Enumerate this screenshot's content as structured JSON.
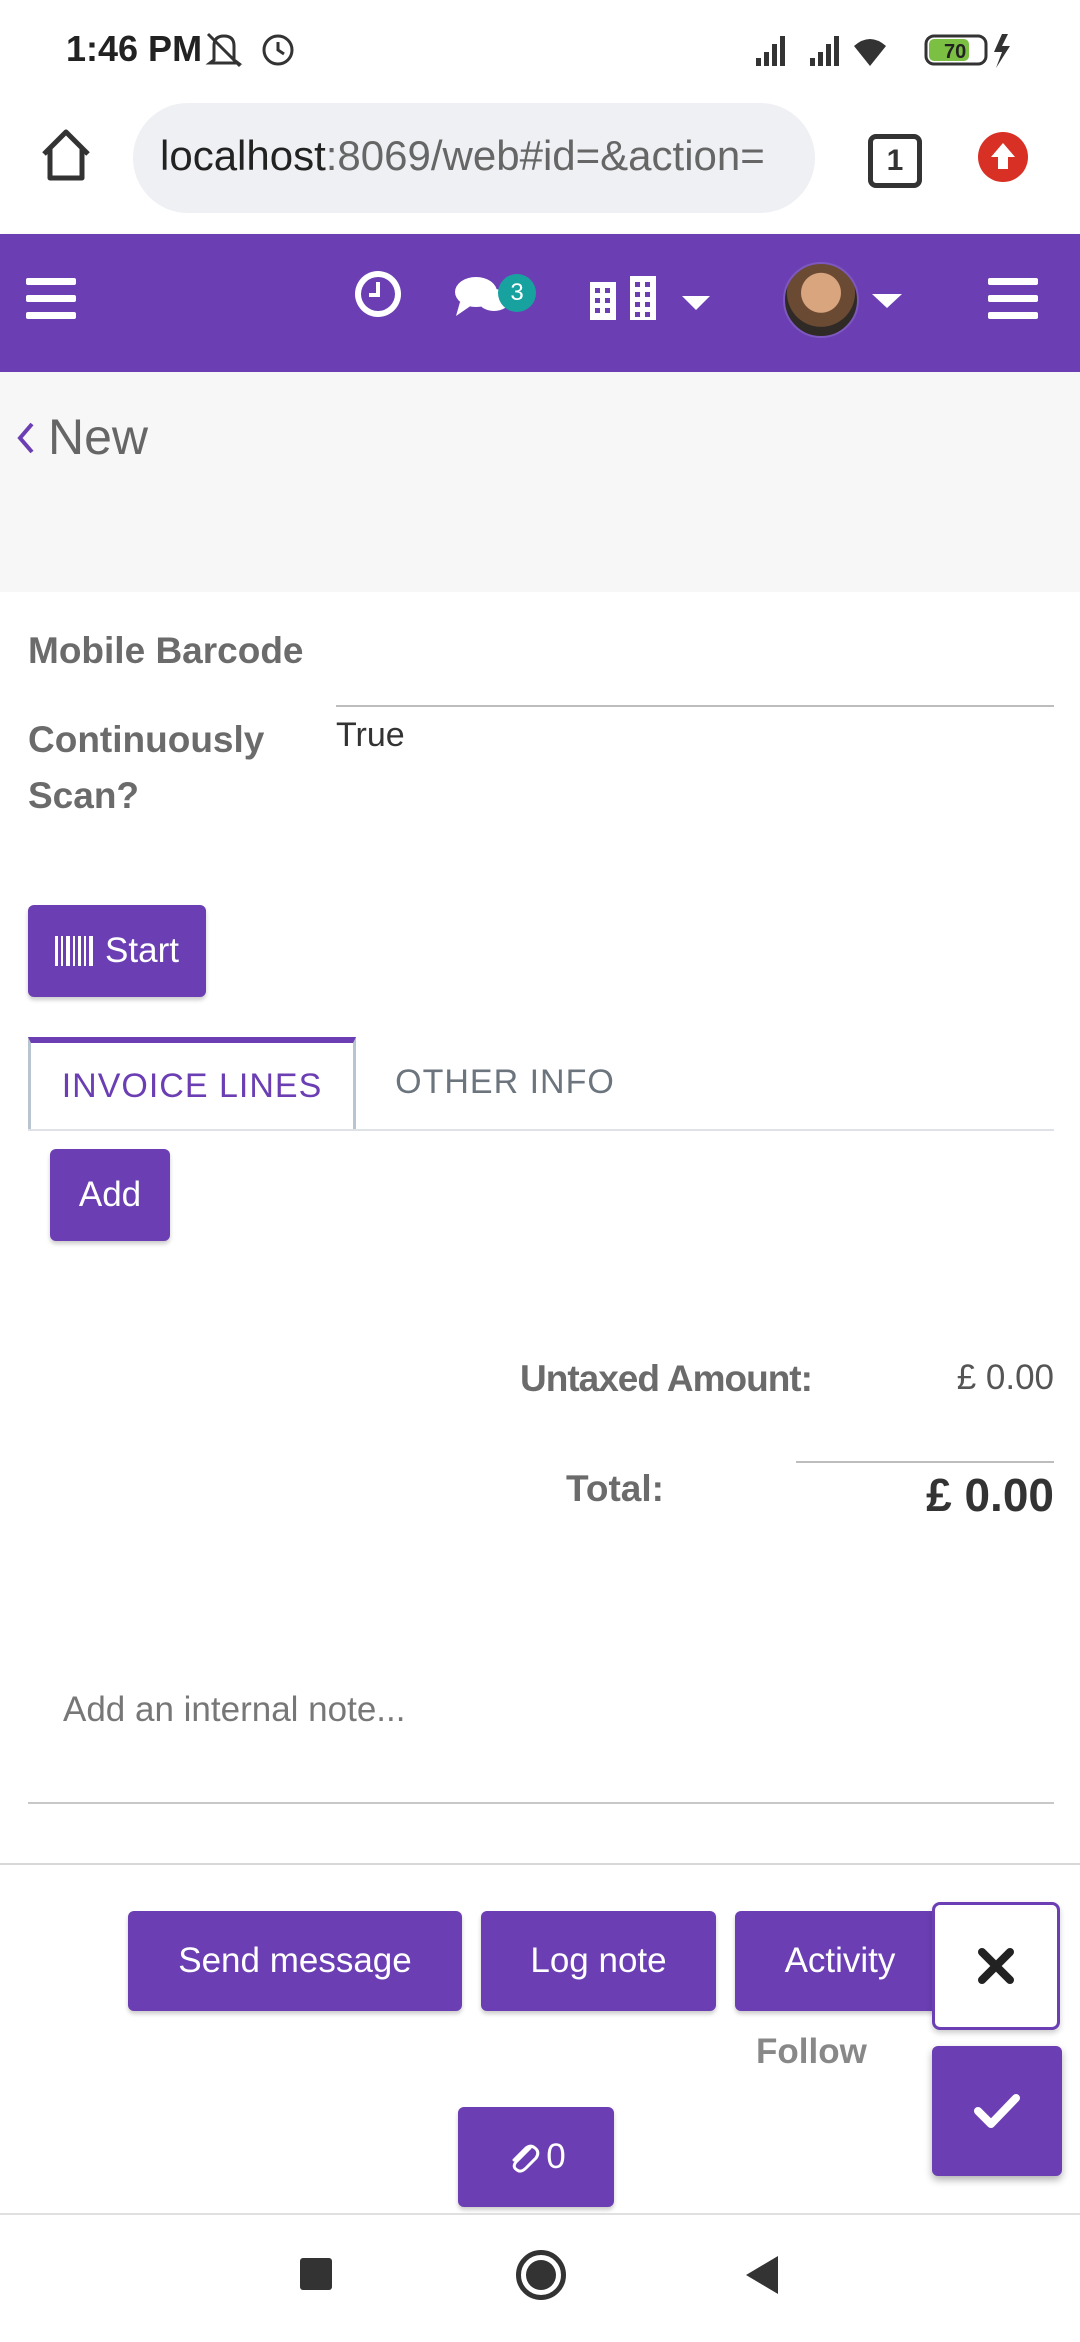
{
  "status_bar": {
    "time": "1:46 PM",
    "battery": "70"
  },
  "browser": {
    "url_host": "localhost",
    "url_rest": ":8069/web#id=&action=",
    "tab_count": "1"
  },
  "navbar": {
    "message_count": "3"
  },
  "breadcrumb": {
    "title": "New"
  },
  "form": {
    "mobile_barcode_label": "Mobile Barcode",
    "continuously_scan_label": "Continuously Scan?",
    "continuously_scan_value": "True",
    "start_button": "Start",
    "tabs": [
      {
        "label": "INVOICE LINES"
      },
      {
        "label": "OTHER INFO"
      }
    ],
    "add_button": "Add",
    "untaxed_label": "Untaxed Amount:",
    "untaxed_value": "£ 0.00",
    "total_label": "Total:",
    "total_value": "£ 0.00",
    "note_placeholder": "Add an internal note..."
  },
  "chatter": {
    "send_message": "Send message",
    "log_note": "Log note",
    "activity": "Activity",
    "follow": "Follow",
    "attachments_count": "0"
  },
  "colors": {
    "primary": "#6b3fb3",
    "badge": "#17a2a0",
    "update": "#d93025"
  }
}
